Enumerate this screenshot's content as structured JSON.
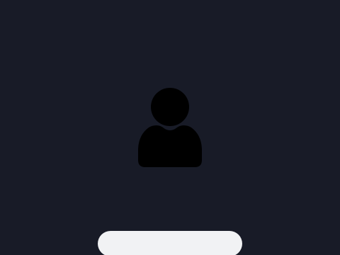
{
  "screen": {
    "background_color": "#181b27",
    "avatar_icon": "user-silhouette-icon",
    "avatar_color": "#000000",
    "bottom_button_label": "",
    "bottom_button_color": "#f1f2f4"
  }
}
